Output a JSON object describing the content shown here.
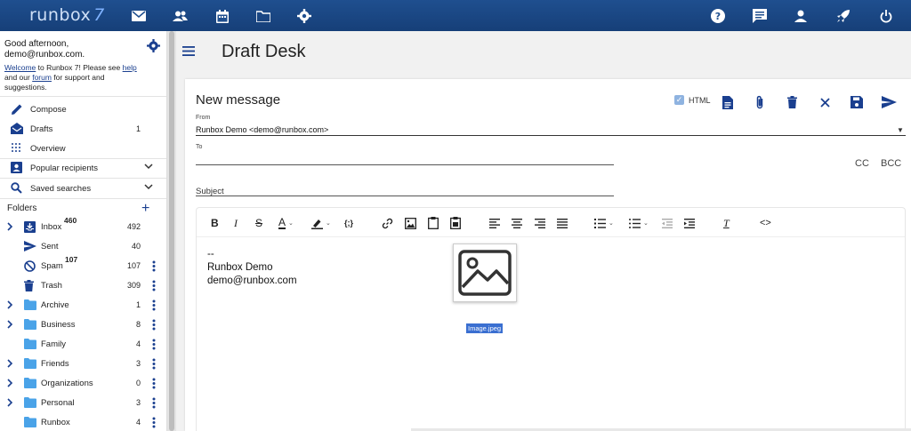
{
  "app": {
    "logo_text": "runbox",
    "logo_version": "7"
  },
  "topbar": {
    "left_icons": [
      "mail-icon",
      "contacts-icon",
      "calendar-icon",
      "files-icon",
      "settings-icon"
    ],
    "right_icons": [
      "help-icon",
      "feedback-icon",
      "account-icon",
      "upgrade-rocket-icon",
      "logout-power-icon"
    ]
  },
  "sidebar": {
    "greeting_line1": "Good afternoon,",
    "greeting_line2": "demo@runbox.com.",
    "welcome_link": "Welcome",
    "welcome_text1": " to Runbox 7! Please see",
    "help_link": "help",
    "welcome_text2": " and our ",
    "forum_link": "forum",
    "welcome_text3": " for support and suggestions.",
    "compose": "Compose",
    "drafts": "Drafts",
    "drafts_count": "1",
    "overview": "Overview",
    "popular_recipients": "Popular recipients",
    "saved_searches": "Saved searches",
    "folders_header": "Folders",
    "folders": [
      {
        "name": "Inbox",
        "unread": "460",
        "count": "492"
      },
      {
        "name": "Sent",
        "unread": "",
        "count": "40"
      },
      {
        "name": "Spam",
        "unread": "107",
        "count": "107"
      },
      {
        "name": "Trash",
        "unread": "",
        "count": "309"
      },
      {
        "name": "Archive",
        "unread": "",
        "count": "1"
      },
      {
        "name": "Business",
        "unread": "",
        "count": "8"
      },
      {
        "name": "Family",
        "unread": "",
        "count": "4"
      },
      {
        "name": "Friends",
        "unread": "",
        "count": "3"
      },
      {
        "name": "Organizations",
        "unread": "",
        "count": "0"
      },
      {
        "name": "Personal",
        "unread": "",
        "count": "3"
      },
      {
        "name": "Runbox",
        "unread": "",
        "count": "4"
      }
    ]
  },
  "main": {
    "page_title": "Draft Desk",
    "compose": {
      "title": "New message",
      "html_label": "HTML",
      "from_label": "From",
      "from_value": "Runbox Demo <demo@runbox.com>",
      "to_label": "To",
      "subject_label": "Subject",
      "cc_label": "CC",
      "bcc_label": "BCC",
      "body_line1": "--",
      "body_line2": "Runbox Demo",
      "body_line3": "demo@runbox.com",
      "image_caption": "Image.jpeg"
    }
  },
  "colors": {
    "topbar": "#1f4f8f",
    "accent": "#1a3f8f",
    "folder_icon": "#4aa3e8"
  }
}
